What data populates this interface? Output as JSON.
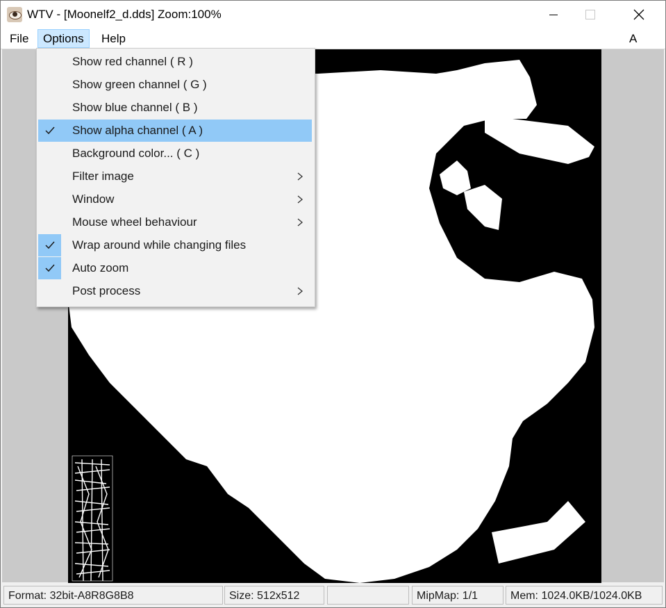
{
  "window": {
    "title": "WTV - [Moonelf2_d.dds] Zoom:100%"
  },
  "menubar": {
    "file": "File",
    "options": "Options",
    "help": "Help",
    "channel_indicator": "A"
  },
  "options_menu": {
    "items": [
      {
        "label": "Show red channel ( R )",
        "checked": false,
        "submenu": false
      },
      {
        "label": "Show green channel ( G )",
        "checked": false,
        "submenu": false
      },
      {
        "label": "Show blue channel ( B )",
        "checked": false,
        "submenu": false
      },
      {
        "label": "Show alpha channel ( A )",
        "checked": true,
        "submenu": false,
        "highlighted": true
      },
      {
        "label": "Background color... ( C )",
        "checked": false,
        "submenu": false
      },
      {
        "label": "Filter image",
        "checked": false,
        "submenu": true
      },
      {
        "label": "Window",
        "checked": false,
        "submenu": true
      },
      {
        "label": "Mouse wheel behaviour",
        "checked": false,
        "submenu": true
      },
      {
        "label": "Wrap around while changing files",
        "checked": true,
        "submenu": false
      },
      {
        "label": "Auto zoom",
        "checked": true,
        "submenu": false
      },
      {
        "label": "Post process",
        "checked": false,
        "submenu": true
      }
    ]
  },
  "statusbar": {
    "format": "Format: 32bit-A8R8G8B8",
    "size": "Size: 512x512",
    "blank": "",
    "mipmap": "MipMap: 1/1",
    "memory": "Mem: 1024.0KB/1024.0KB"
  },
  "colors": {
    "highlight": "#91c9f7",
    "menu_active": "#cce8ff",
    "canvas_bg": "#c9c9c9"
  }
}
